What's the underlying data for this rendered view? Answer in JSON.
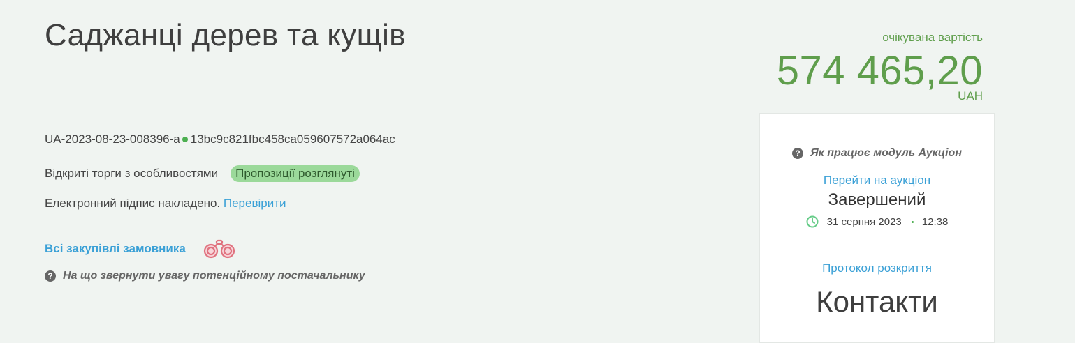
{
  "tender": {
    "title": "Саджанці дерев та кущів",
    "id": "UA-2023-08-23-008396-a",
    "hash": "13bc9c821fbc458ca059607572a064ac",
    "procedure": "Відкриті торги з особливостями",
    "status_badge": "Пропозиції розглянуті",
    "signature_text": "Електронний підпис накладено.",
    "signature_check_link": "Перевірити",
    "buyer_purchases_link": "Всі закупівлі замовника",
    "supplier_hint": "На що звернути увагу потенційному постачальнику"
  },
  "price": {
    "label": "очікувана вартість",
    "value": "574 465,20",
    "currency": "UAH"
  },
  "auction_card": {
    "how_it_works": "Як працює модуль Аукціон",
    "goto_auction": "Перейти на аукціон",
    "status": "Завершений",
    "date": "31 серпня 2023",
    "time": "12:38",
    "protocol_link": "Протокол розкриття",
    "contacts_heading": "Контакти"
  },
  "icons": {
    "help": "question-circle-icon",
    "clock": "clock-icon",
    "binoculars": "binoculars-icon"
  },
  "colors": {
    "background": "#f0f4f1",
    "link": "#3aa0d6",
    "price": "#5f9e4c",
    "badge": "#9bd99a",
    "clock": "#66cc88",
    "binoculars": "#e0727f"
  }
}
